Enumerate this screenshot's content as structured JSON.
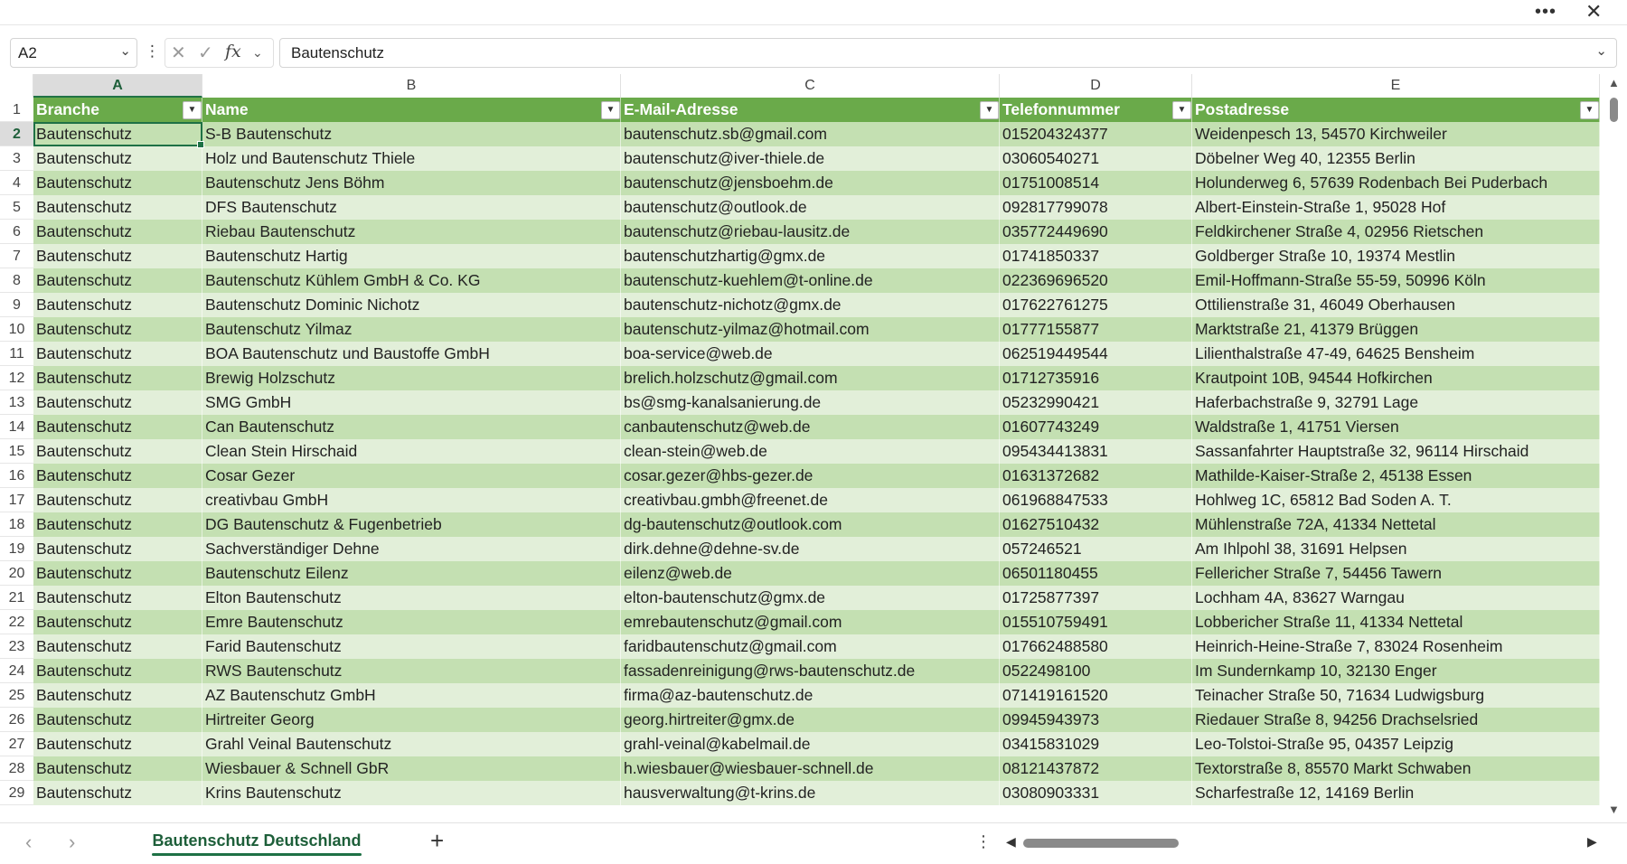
{
  "window": {
    "more_icon": "more-horizontal-icon",
    "close_icon": "close-icon",
    "more_glyph": "•••",
    "close_glyph": "✕"
  },
  "formula_bar": {
    "name_box": "A2",
    "formula": "Bautenschutz",
    "fx_label": "fx",
    "cancel_glyph": "✕",
    "enter_glyph": "✓"
  },
  "columns": [
    "A",
    "B",
    "C",
    "D",
    "E"
  ],
  "table": {
    "headers": [
      "Branche",
      "Name",
      "E-Mail-Adresse",
      "Telefonnummer",
      "Postadresse"
    ],
    "rows": [
      [
        "2",
        "Bautenschutz",
        "S-B Bautenschutz",
        "bautenschutz.sb@gmail.com",
        "015204324377",
        "Weidenpesch 13, 54570 Kirchweiler"
      ],
      [
        "3",
        "Bautenschutz",
        "Holz und Bautenschutz Thiele",
        "bautenschutz@iver-thiele.de",
        "03060540271",
        "Döbelner Weg 40, 12355 Berlin"
      ],
      [
        "4",
        "Bautenschutz",
        "Bautenschutz Jens Böhm",
        "bautenschutz@jensboehm.de",
        "01751008514",
        "Holunderweg 6, 57639 Rodenbach Bei Puderbach"
      ],
      [
        "5",
        "Bautenschutz",
        "DFS Bautenschutz",
        "bautenschutz@outlook.de",
        "092817799078",
        "Albert-Einstein-Straße 1, 95028 Hof"
      ],
      [
        "6",
        "Bautenschutz",
        "Riebau Bautenschutz",
        "bautenschutz@riebau-lausitz.de",
        "035772449690",
        "Feldkirchener Straße 4, 02956 Rietschen"
      ],
      [
        "7",
        "Bautenschutz",
        "Bautenschutz Hartig",
        "bautenschutzhartig@gmx.de",
        "01741850337",
        "Goldberger Straße 10, 19374 Mestlin"
      ],
      [
        "8",
        "Bautenschutz",
        "Bautenschutz Kühlem GmbH & Co. KG",
        "bautenschutz-kuehlem@t-online.de",
        "022369696520",
        "Emil-Hoffmann-Straße 55-59, 50996 Köln"
      ],
      [
        "9",
        "Bautenschutz",
        "Bautenschutz Dominic Nichotz",
        "bautenschutz-nichotz@gmx.de",
        "017622761275",
        "Ottilienstraße 31, 46049 Oberhausen"
      ],
      [
        "10",
        "Bautenschutz",
        "Bautenschutz Yilmaz",
        "bautenschutz-yilmaz@hotmail.com",
        "01777155877",
        "Marktstraße 21, 41379 Brüggen"
      ],
      [
        "11",
        "Bautenschutz",
        "BOA Bautenschutz und Baustoffe GmbH",
        "boa-service@web.de",
        "062519449544",
        "Lilienthalstraße 47-49, 64625 Bensheim"
      ],
      [
        "12",
        "Bautenschutz",
        "Brewig Holzschutz",
        "brelich.holzschutz@gmail.com",
        "01712735916",
        "Krautpoint 10B, 94544 Hofkirchen"
      ],
      [
        "13",
        "Bautenschutz",
        "SMG GmbH",
        "bs@smg-kanalsanierung.de",
        "05232990421",
        "Haferbachstraße 9, 32791 Lage"
      ],
      [
        "14",
        "Bautenschutz",
        "Can Bautenschutz",
        "canbautenschutz@web.de",
        "01607743249",
        "Waldstraße 1, 41751 Viersen"
      ],
      [
        "15",
        "Bautenschutz",
        "Clean Stein Hirschaid",
        "clean-stein@web.de",
        "095434413831",
        "Sassanfahrter Hauptstraße 32, 96114 Hirschaid"
      ],
      [
        "16",
        "Bautenschutz",
        "Cosar Gezer",
        "cosar.gezer@hbs-gezer.de",
        "01631372682",
        "Mathilde-Kaiser-Straße 2, 45138 Essen"
      ],
      [
        "17",
        "Bautenschutz",
        "creativbau GmbH",
        "creativbau.gmbh@freenet.de",
        "061968847533",
        "Hohlweg 1C, 65812 Bad Soden A. T."
      ],
      [
        "18",
        "Bautenschutz",
        "DG Bautenschutz & Fugenbetrieb",
        "dg-bautenschutz@outlook.com",
        "01627510432",
        "Mühlenstraße 72A, 41334 Nettetal"
      ],
      [
        "19",
        "Bautenschutz",
        "Sachverständiger Dehne",
        "dirk.dehne@dehne-sv.de",
        "057246521",
        "Am Ihlpohl 38, 31691 Helpsen"
      ],
      [
        "20",
        "Bautenschutz",
        "Bautenschutz Eilenz",
        "eilenz@web.de",
        "06501180455",
        "Fellericher Straße 7, 54456 Tawern"
      ],
      [
        "21",
        "Bautenschutz",
        "Elton Bautenschutz",
        "elton-bautenschutz@gmx.de",
        "01725877397",
        "Lochham 4A, 83627 Warngau"
      ],
      [
        "22",
        "Bautenschutz",
        "Emre Bautenschutz",
        "emrebautenschutz@gmail.com",
        "015510759491",
        "Lobbericher Straße 11, 41334 Nettetal"
      ],
      [
        "23",
        "Bautenschutz",
        "Farid Bautenschutz",
        "faridbautenschutz@gmail.com",
        "017662488580",
        "Heinrich-Heine-Straße 7, 83024 Rosenheim"
      ],
      [
        "24",
        "Bautenschutz",
        "RWS Bautenschutz",
        "fassadenreinigung@rws-bautenschutz.de",
        "0522498100",
        "Im Sundernkamp 10, 32130 Enger"
      ],
      [
        "25",
        "Bautenschutz",
        "AZ Bautenschutz GmbH",
        "firma@az-bautenschutz.de",
        "071419161520",
        "Teinacher Straße 50, 71634 Ludwigsburg"
      ],
      [
        "26",
        "Bautenschutz",
        "Hirtreiter Georg",
        "georg.hirtreiter@gmx.de",
        "09945943973",
        "Riedauer Straße 8, 94256 Drachselsried"
      ],
      [
        "27",
        "Bautenschutz",
        "Grahl Veinal Bautenschutz",
        "grahl-veinal@kabelmail.de",
        "03415831029",
        "Leo-Tolstoi-Straße 95, 04357 Leipzig"
      ],
      [
        "28",
        "Bautenschutz",
        "Wiesbauer & Schnell GbR",
        "h.wiesbauer@wiesbauer-schnell.de",
        "08121437872",
        "Textorstraße 8, 85570 Markt Schwaben"
      ],
      [
        "29",
        "Bautenschutz",
        "Krins Bautenschutz",
        "hausverwaltung@t-krins.de",
        "03080903331",
        "Scharfestraße 12, 14169 Berlin"
      ]
    ]
  },
  "sheet_tabs": {
    "active": "Bautenschutz Deutschland",
    "add_glyph": "+"
  },
  "colors": {
    "header_green": "#6aaa4a",
    "band_dark": "#c4e0b2",
    "band_light": "#e2efd9",
    "accent": "#1e7145"
  }
}
